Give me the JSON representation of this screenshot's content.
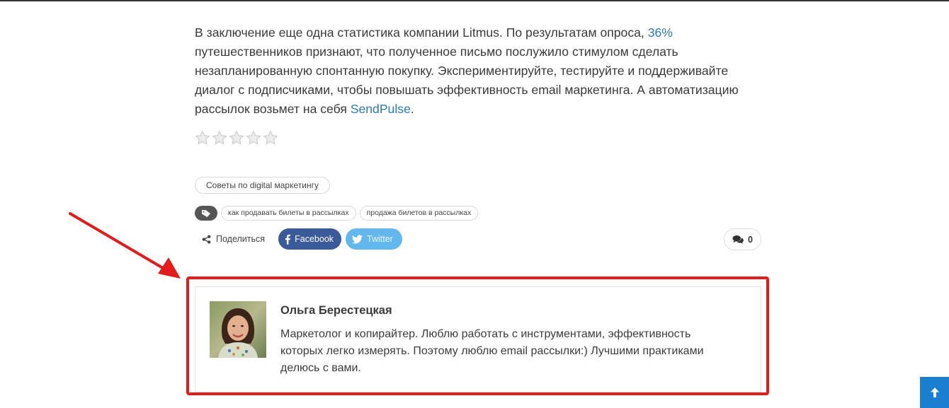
{
  "article": {
    "text_before_link1": "В заключение еще одна статистика компании Litmus. По результатам опроса, ",
    "link1": "36%",
    "text_middle": " путешественников признают, что полученное письмо послужило стимулом сделать незапланированную спонтанную покупку. Экспериментируйте, тестируйте и поддерживайте диалог с подписчиками, чтобы повышать эффективность email маркетинга. А автоматизацию рассылок возьмет на себя ",
    "link2": "SendPulse",
    "text_end": ".",
    "link_color": "#2a7ab8"
  },
  "rating": {
    "stars_total": 5,
    "stars_filled": 0
  },
  "category": {
    "label": "Советы по digital маркетингу"
  },
  "tags": {
    "icon": "tag-icon",
    "items": [
      "как продавать билеты в рассылках",
      "продажа билетов в рассылках"
    ]
  },
  "share": {
    "label": "Поделиться",
    "icon": "share-icon",
    "facebook_label": "Facebook",
    "twitter_label": "Twitter",
    "facebook_color": "#3b5a9a",
    "twitter_color": "#62b8ec"
  },
  "comments": {
    "icon": "comments-icon",
    "count": "0"
  },
  "author": {
    "name": "Ольга Берестецкая",
    "bio": "Маркетолог и копирайтер. Люблю работать с инструментами, эффективность которых легко измерять. Поэтому люблю email рассылки:) Лучшими практиками делюсь с вами."
  },
  "annotation": {
    "color": "#e31b1b"
  },
  "back_to_top": {
    "icon": "arrow-up-icon",
    "color": "#1a7fd0"
  }
}
